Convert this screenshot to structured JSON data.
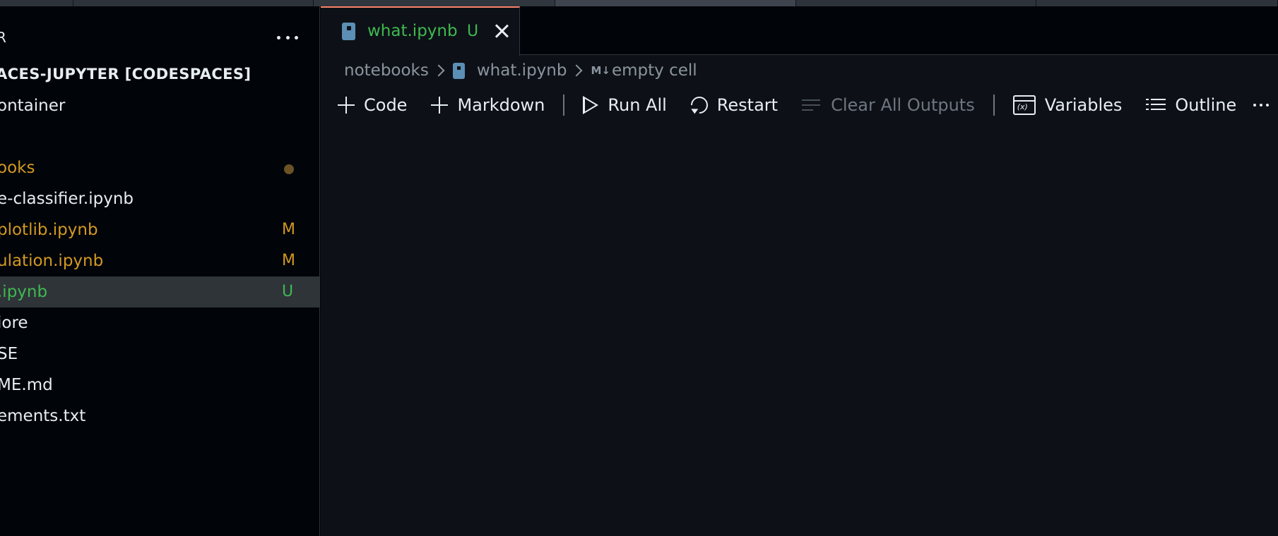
{
  "sidebar": {
    "title": "R",
    "items": [
      {
        "label": "ACES-JUPYTER [CODESPACES]",
        "badge": "",
        "color": "#e6edf3"
      },
      {
        "label": "ontainer",
        "badge": "",
        "color": "#e6edf3"
      },
      {
        "label": "ooks",
        "badge": "",
        "color": "#d29922"
      },
      {
        "label": "e-classifier.ipynb",
        "badge": "",
        "color": "#e6edf3"
      },
      {
        "label": "plotlib.ipynb",
        "badge": "M",
        "color": "#d29922"
      },
      {
        "label": "ulation.ipynb",
        "badge": "M",
        "color": "#d29922"
      },
      {
        "label": ".ipynb",
        "badge": "U",
        "color": "#3fb950"
      },
      {
        "label": "iore",
        "badge": "",
        "color": "#e6edf3"
      },
      {
        "label": "SE",
        "badge": "",
        "color": "#e6edf3"
      },
      {
        "label": "ME.md",
        "badge": "",
        "color": "#e6edf3"
      },
      {
        "label": "ements.txt",
        "badge": "",
        "color": "#e6edf3"
      }
    ]
  },
  "tab": {
    "label": "what.ipynb",
    "status": "U",
    "icon": "notebook-icon"
  },
  "breadcrumb": {
    "folder": "notebooks",
    "file": "what.ipynb",
    "md_tag": "M↓",
    "cell": "empty cell"
  },
  "toolbar": {
    "code": "Code",
    "markdown": "Markdown",
    "run_all": "Run All",
    "restart": "Restart",
    "clear_outputs": "Clear All Outputs",
    "variables": "Variables",
    "outline": "Outline"
  }
}
